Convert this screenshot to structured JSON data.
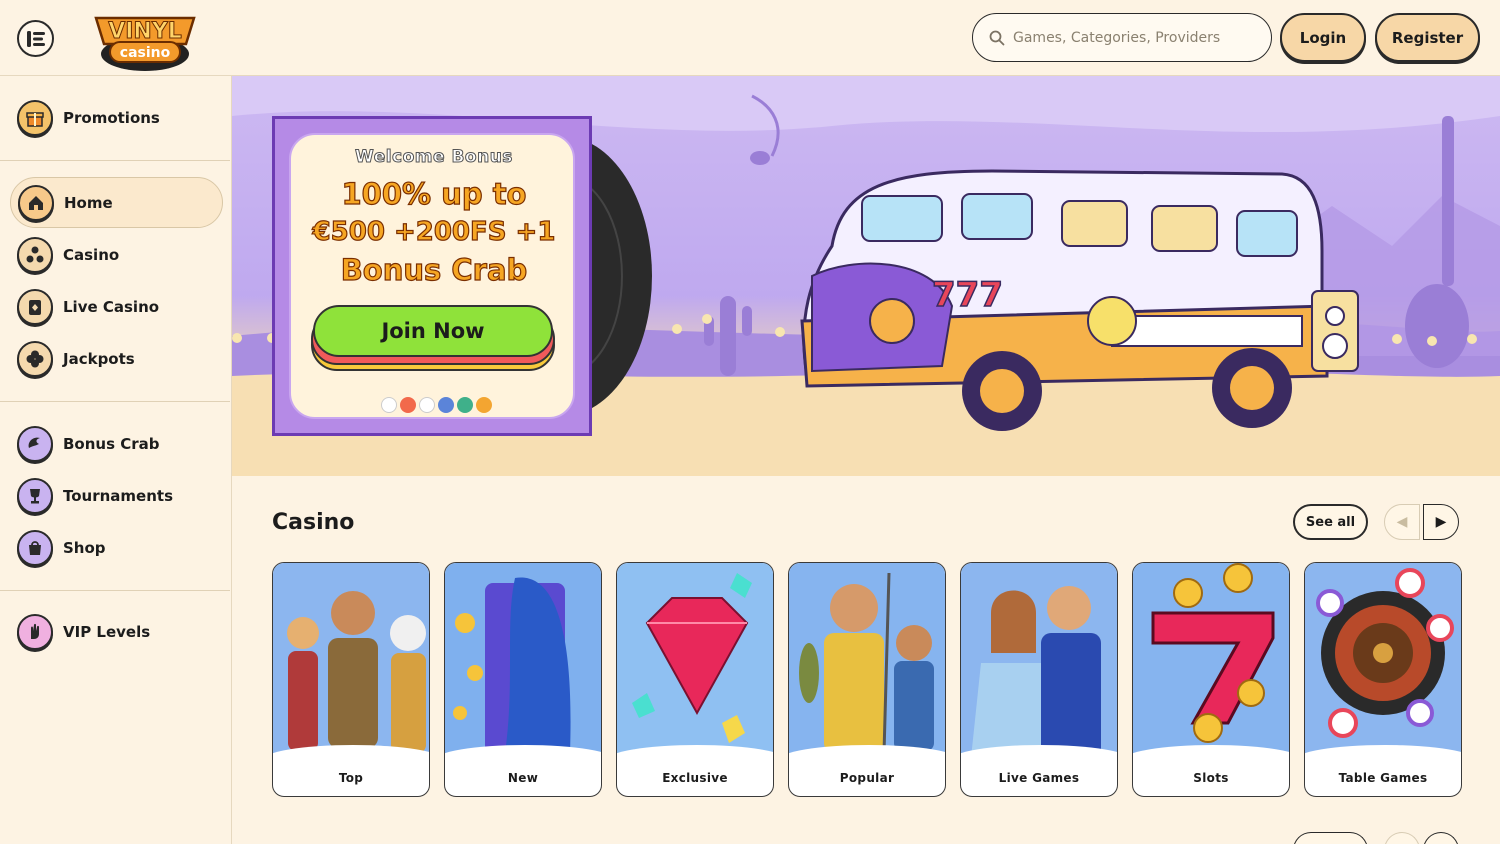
{
  "header": {
    "logo_text": "VINYL casino",
    "search_placeholder": "Games, Categories, Providers",
    "login_label": "Login",
    "register_label": "Register"
  },
  "sidebar": {
    "groups": [
      {
        "items": [
          {
            "label": "Promotions",
            "icon": "gift-icon",
            "active": false
          }
        ]
      },
      {
        "items": [
          {
            "label": "Home",
            "icon": "home-icon",
            "active": true
          },
          {
            "label": "Casino",
            "icon": "dice-icon",
            "active": false
          },
          {
            "label": "Live Casino",
            "icon": "cards-icon",
            "active": false
          },
          {
            "label": "Jackpots",
            "icon": "clover-icon",
            "active": false
          }
        ]
      },
      {
        "items": [
          {
            "label": "Bonus Crab",
            "icon": "crab-claw-icon",
            "active": false
          },
          {
            "label": "Tournaments",
            "icon": "trophy-icon",
            "active": false
          },
          {
            "label": "Shop",
            "icon": "shopping-bag-icon",
            "active": false
          }
        ]
      },
      {
        "items": [
          {
            "label": "VIP Levels",
            "icon": "hand-icon",
            "active": false
          }
        ]
      }
    ]
  },
  "hero": {
    "subtitle": "Welcome Bonus",
    "headline_line1": "100% up to",
    "headline_line2": "€500 +200FS +1",
    "headline_line3": "Bonus Crab",
    "cta_label": "Join Now",
    "payment_icons": [
      "visa-icon",
      "mastercard-icon",
      "bank-icon",
      "ethereum-icon",
      "tether-icon",
      "bitcoin-icon"
    ]
  },
  "casino_section": {
    "title": "Casino",
    "see_all_label": "See all",
    "categories": [
      {
        "label": "Top",
        "art": "adventurer-gods-art"
      },
      {
        "label": "New",
        "art": "slot-machine-reveal-art"
      },
      {
        "label": "Exclusive",
        "art": "gem-diamond-art"
      },
      {
        "label": "Popular",
        "art": "fishermen-art"
      },
      {
        "label": "Live Games",
        "art": "live-hosts-art"
      },
      {
        "label": "Slots",
        "art": "lucky-seven-art"
      },
      {
        "label": "Table Games",
        "art": "roulette-wheel-art"
      }
    ]
  },
  "colors": {
    "background": "#fdf3e3",
    "hero_purple": "#bfa9ef",
    "button_peach": "#f7d7a7",
    "cta_green": "#8fe23a",
    "headline_orange": "#f6a623"
  }
}
